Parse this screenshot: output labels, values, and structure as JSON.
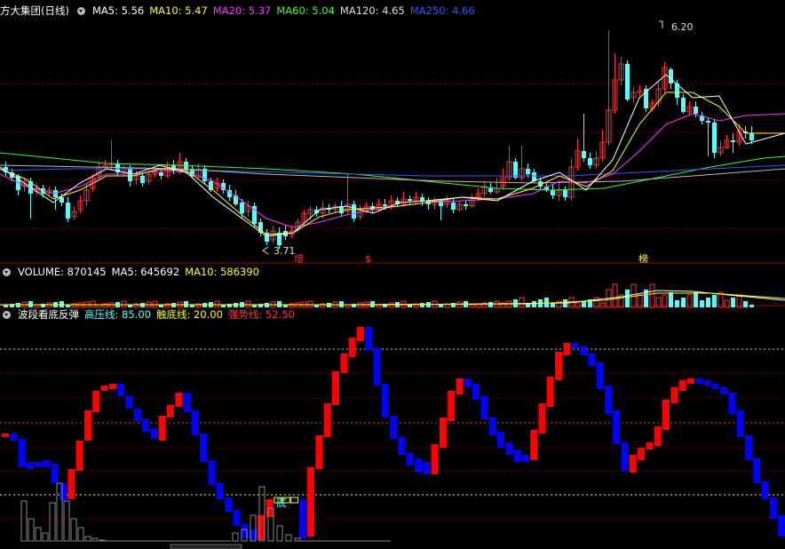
{
  "price_panel": {
    "stock_name": "方大集团",
    "period": "(日线)",
    "ma_labels": [
      {
        "label": "MA5: 5.56",
        "color": "#ffffff"
      },
      {
        "label": "MA10: 5.47",
        "color": "#ffff00"
      },
      {
        "label": "MA20: 5.37",
        "color": "#ff33ff"
      },
      {
        "label": "MA60: 5.04",
        "color": "#33ff33"
      },
      {
        "label": "MA120: 4.65",
        "color": "#dddddd"
      },
      {
        "label": "MA250: 4.66",
        "color": "#3355ff"
      }
    ],
    "high_label": "6.20",
    "low_label": "3.71",
    "markers": [
      "增",
      "$",
      "榜"
    ]
  },
  "volume_panel": {
    "title": "VOLUME: 870145",
    "ma5": "MA5: 645692",
    "ma10": "MA10: 586390"
  },
  "indicator_panel": {
    "title": "波段看底反弹",
    "high_line": "高压线: 85.00",
    "touch_line": "触底线: 20.00",
    "strong_line": "强势线: 52.50",
    "bottom_label": "底"
  },
  "colors": {
    "up": "#ff3232",
    "down": "#54ffff",
    "red_bar": "#ff0000",
    "blue_bar": "#0000ff",
    "bg": "#000000"
  }
}
